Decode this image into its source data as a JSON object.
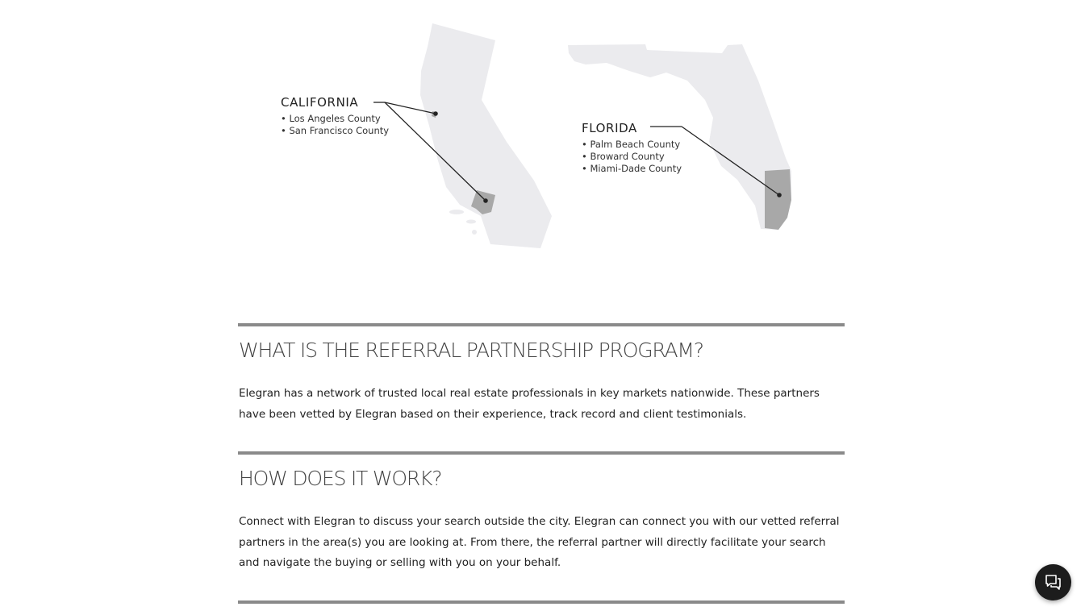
{
  "map": {
    "california": {
      "name": "CALIFORNIA",
      "counties": [
        "• Los Angeles County",
        "• San Francisco County"
      ]
    },
    "florida": {
      "name": "FLORIDA",
      "counties": [
        "• Palm Beach County",
        "• Broward County",
        "• Miami-Dade County"
      ]
    },
    "colors": {
      "state_fill": "#ebebee",
      "county_fill": "#a8a8a8",
      "leader_line": "#222222"
    }
  },
  "sections": [
    {
      "title": "WHAT IS THE REFERRAL PARTNERSHIP PROGRAM?",
      "body": "Elegran has a network of trusted local real estate professionals in key markets nationwide. These partners have been vetted by Elegran based on their experience, track record and client testimonials."
    },
    {
      "title": "HOW DOES IT WORK?",
      "body": "Connect with Elegran to discuss your search outside the city. Elegran can connect you with our vetted referral partners in the area(s) you are looking at. From there, the referral partner will directly facilitate your search and navigate the buying or selling with you on your behalf."
    }
  ],
  "chat": {
    "icon": "chat-bubbles-icon"
  }
}
